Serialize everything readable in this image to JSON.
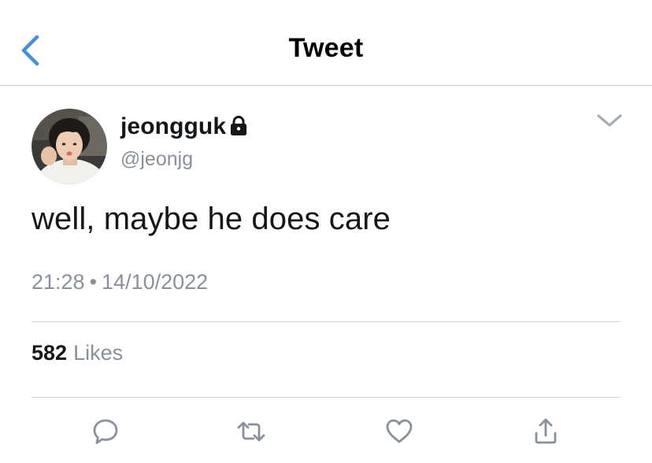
{
  "header": {
    "title": "Tweet",
    "back_icon": "chevron-left-icon",
    "accent_color": "#4a90d9"
  },
  "tweet": {
    "author": {
      "display_name": "jeongguk",
      "handle": "@jeonjg",
      "protected_icon": "lock-icon"
    },
    "text": "well, maybe he does care",
    "time": "21:28",
    "separator": "•",
    "date": "14/10/2022",
    "likes": {
      "count": "582",
      "label": "Likes"
    }
  },
  "actions": [
    {
      "name": "reply",
      "icon": "comment-icon"
    },
    {
      "name": "retweet",
      "icon": "retweet-icon"
    },
    {
      "name": "like",
      "icon": "heart-icon"
    },
    {
      "name": "share",
      "icon": "share-icon"
    }
  ],
  "colors": {
    "primary_text": "#14171a",
    "secondary_text": "#8a9099",
    "divider": "#d4d4d8",
    "icon_gray": "#8a9099"
  }
}
